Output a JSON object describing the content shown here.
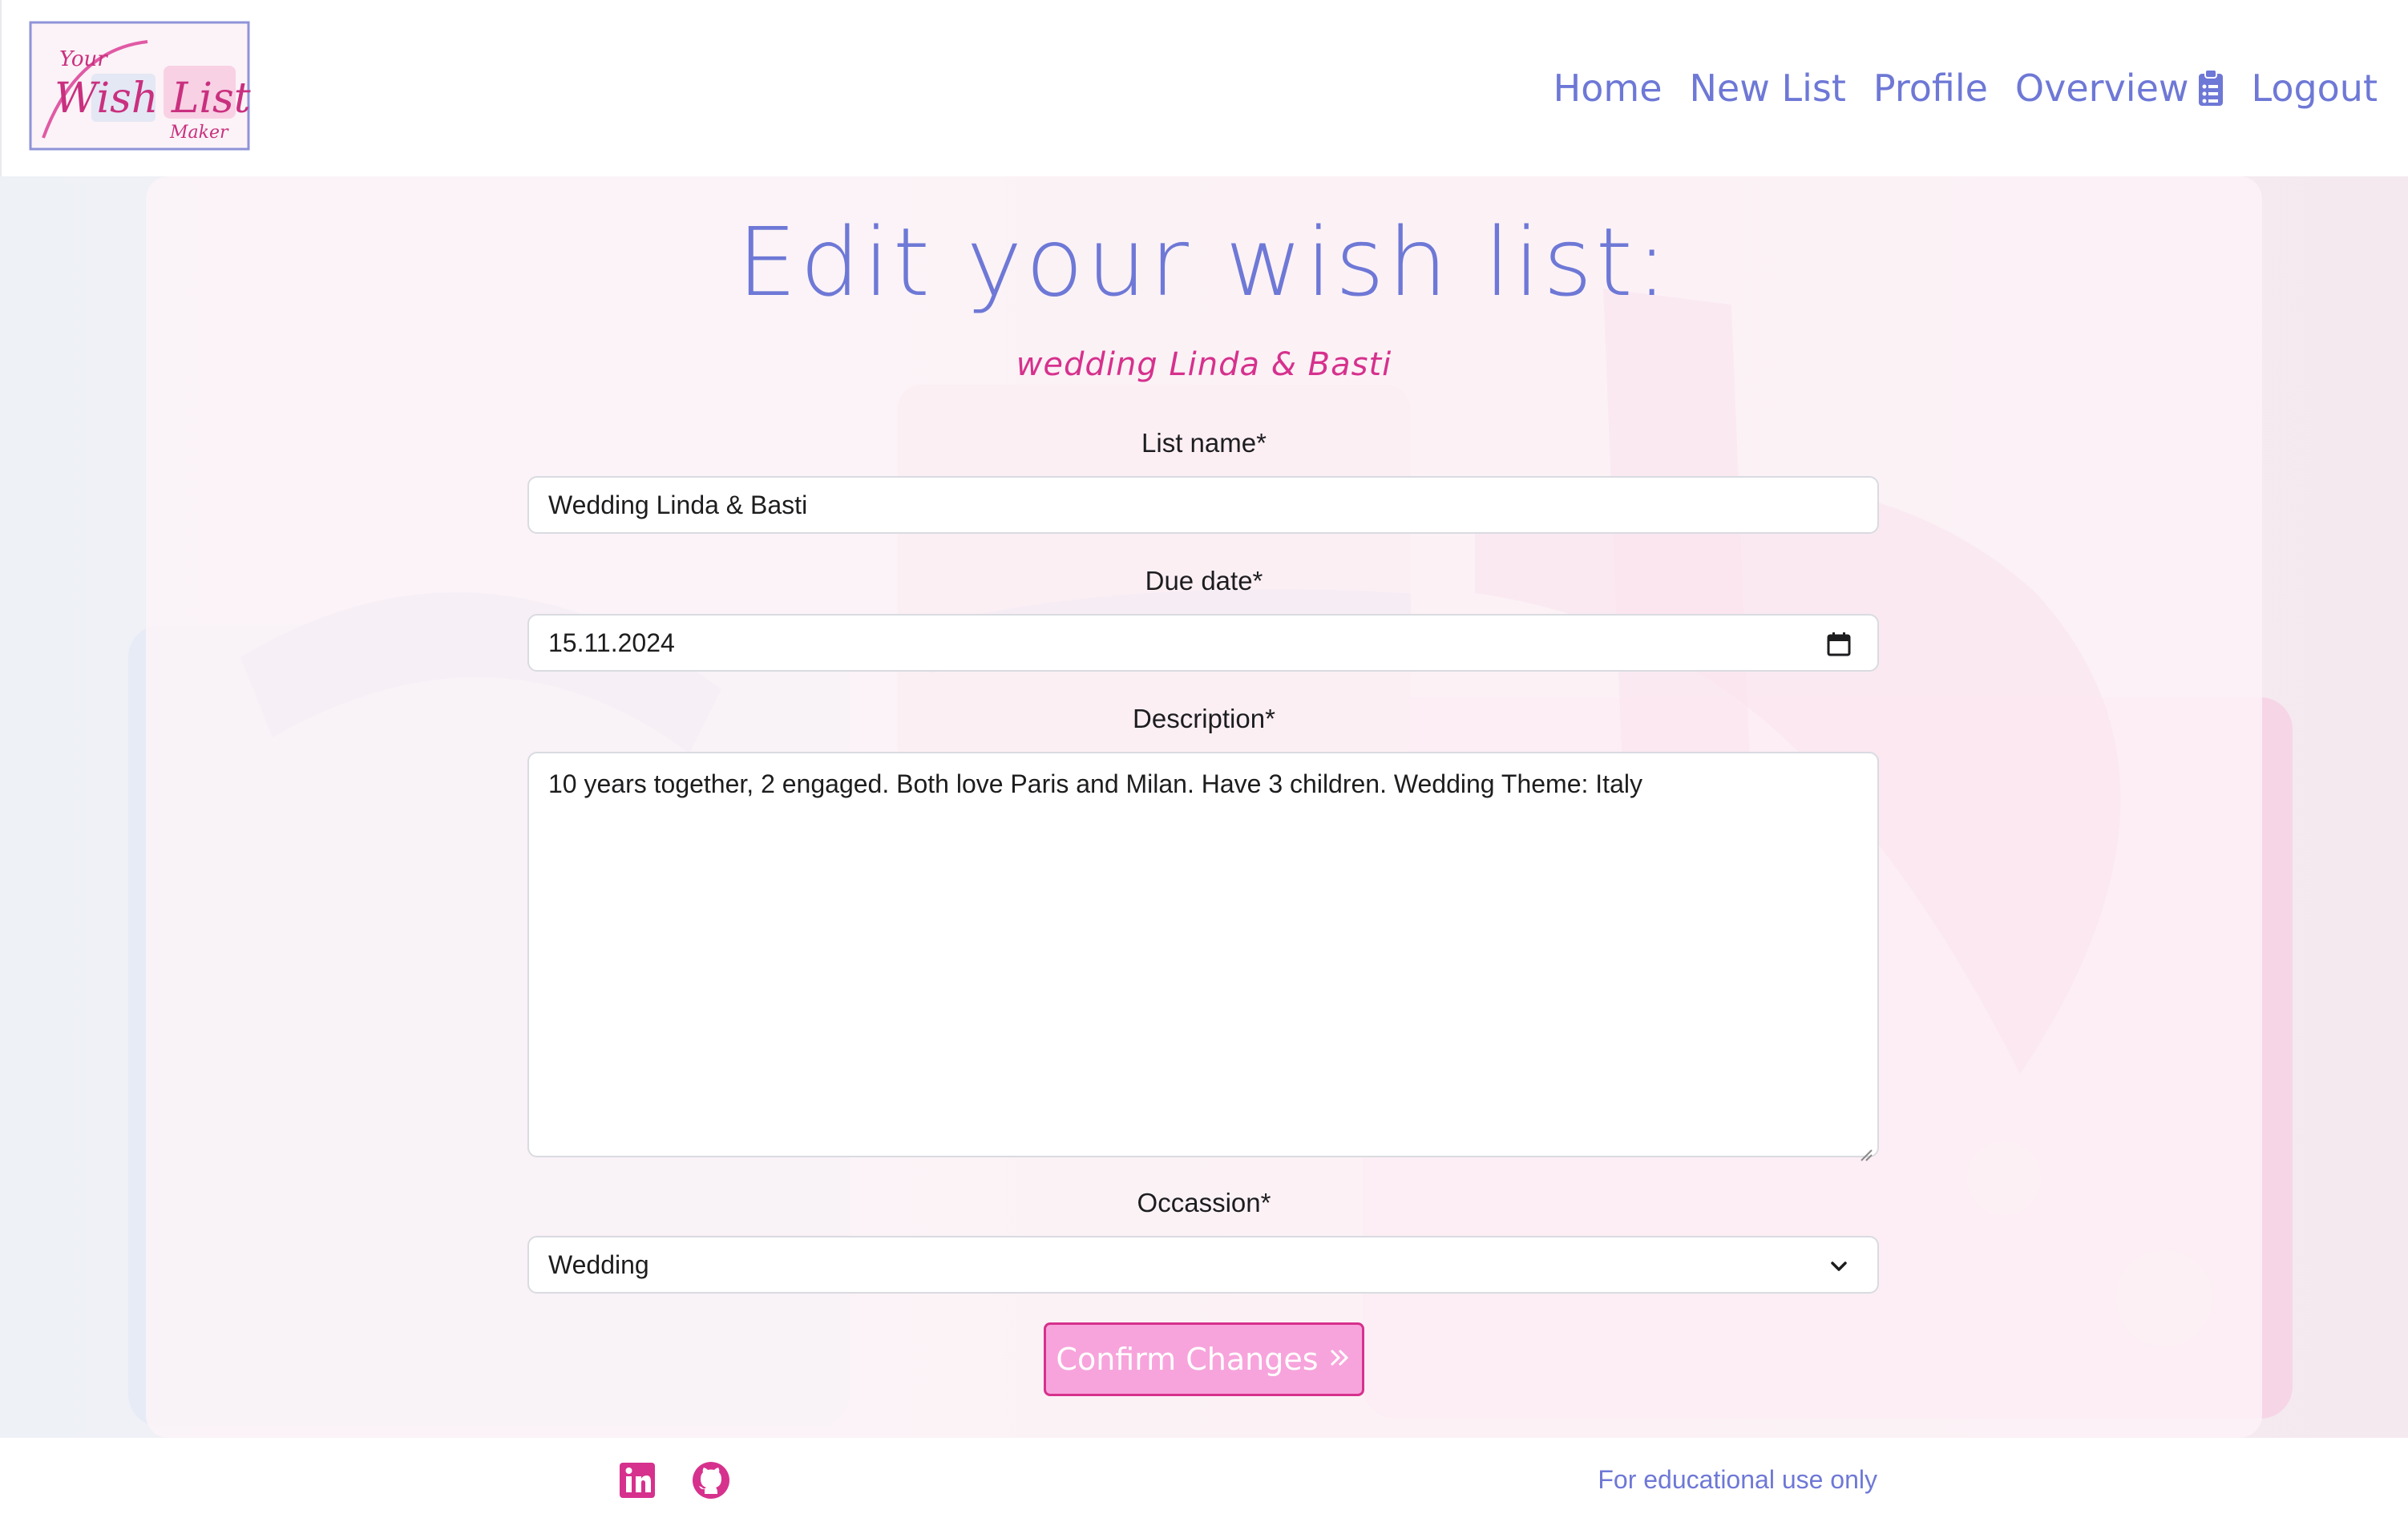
{
  "header": {
    "logo_text": {
      "line1": "Your",
      "line2": "Wish List",
      "line3": "Maker"
    },
    "nav": [
      {
        "label": "Home"
      },
      {
        "label": "New List"
      },
      {
        "label": "Profile"
      },
      {
        "label": "Overview",
        "icon": "clipboard-list-icon"
      },
      {
        "label": "Logout"
      }
    ]
  },
  "form": {
    "title": "Edit your wish list:",
    "subtitle": "wedding Linda & Basti",
    "list_name": {
      "label": "List name*",
      "value": "Wedding Linda & Basti"
    },
    "due_date": {
      "label": "Due date*",
      "value": "15.11.2024",
      "icon": "calendar-icon"
    },
    "description": {
      "label": "Description*",
      "value": "10 years together, 2 engaged. Both love Paris and Milan. Have 3 children. Wedding Theme: Italy"
    },
    "occasion": {
      "label": "Occassion*",
      "value": "Wedding",
      "icon": "chevron-down-icon"
    },
    "submit": {
      "label": "Confirm Changes",
      "icon": "double-chevron-right-icon"
    }
  },
  "footer": {
    "social": [
      {
        "icon": "linkedin-icon"
      },
      {
        "icon": "github-icon"
      }
    ],
    "note": "For educational use only"
  },
  "colors": {
    "accent": "#6e78d6",
    "brand_pink": "#d6318d",
    "button_bg": "#f7a4dc"
  }
}
